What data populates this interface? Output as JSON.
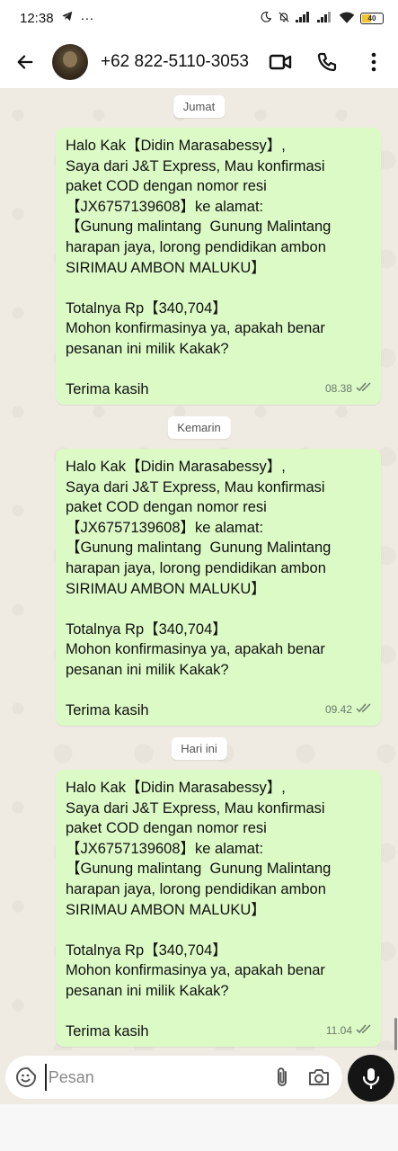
{
  "status_bar": {
    "time": "12:38",
    "extra": "···",
    "battery": "40"
  },
  "header": {
    "contact_name": "+62 822-5110-3053"
  },
  "chat": {
    "groups": [
      {
        "date_label": "Jumat",
        "time": "08.38",
        "lines": [
          "Halo Kak【Didin Marasabessy】,",
          "Saya dari J&T Express, Mau konfirmasi",
          "paket COD dengan nomor resi",
          "【JX6757139608】ke alamat:",
          "【Gunung malintang  Gunung Malintang",
          "harapan jaya, lorong pendidikan ambon",
          "SIRIMAU AMBON MALUKU】",
          "",
          "Totalnya Rp【340,704】",
          "Mohon konfirmasinya ya, apakah benar",
          "pesanan ini milik Kakak?",
          "",
          "Terima kasih"
        ]
      },
      {
        "date_label": "Kemarin",
        "time": "09.42",
        "lines": [
          "Halo Kak【Didin Marasabessy】,",
          "Saya dari J&T Express, Mau konfirmasi",
          "paket COD dengan nomor resi",
          "【JX6757139608】ke alamat:",
          "【Gunung malintang  Gunung Malintang",
          "harapan jaya, lorong pendidikan ambon",
          "SIRIMAU AMBON MALUKU】",
          "",
          "Totalnya Rp【340,704】",
          "Mohon konfirmasinya ya, apakah benar",
          "pesanan ini milik Kakak?",
          "",
          "Terima kasih"
        ]
      },
      {
        "date_label": "Hari ini",
        "time": "11.04",
        "lines": [
          "Halo Kak【Didin Marasabessy】,",
          "Saya dari J&T Express, Mau konfirmasi",
          "paket COD dengan nomor resi",
          "【JX6757139608】ke alamat:",
          "【Gunung malintang  Gunung Malintang",
          "harapan jaya, lorong pendidikan ambon",
          "SIRIMAU AMBON MALUKU】",
          "",
          "Totalnya Rp【340,704】",
          "Mohon konfirmasinya ya, apakah benar",
          "pesanan ini milik Kakak?",
          "",
          "Terima kasih"
        ]
      }
    ]
  },
  "composer": {
    "placeholder": "Pesan"
  },
  "icons": {
    "back": "back-arrow-icon",
    "video": "video-call-icon",
    "phone": "voice-call-icon",
    "menu": "more-vertical-icon",
    "emoji": "sticker-icon",
    "attach": "paperclip-icon",
    "camera": "camera-icon",
    "mic": "microphone-icon",
    "read": "double-check-icon"
  },
  "colors": {
    "bubble_out": "#dcfac6",
    "chat_bg": "#efeae2",
    "mic_button": "#151515"
  }
}
